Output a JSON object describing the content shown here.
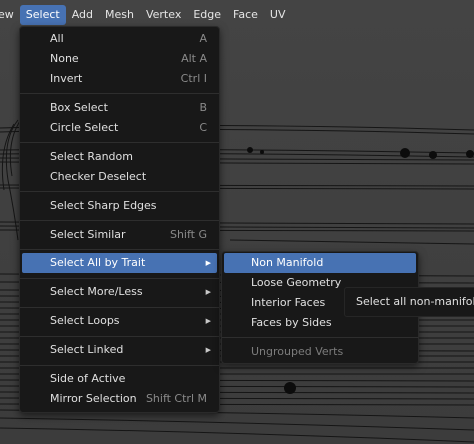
{
  "menubar": {
    "items": [
      {
        "label": "ew",
        "name": "menubar-view"
      },
      {
        "label": "Select",
        "name": "menubar-select"
      },
      {
        "label": "Add",
        "name": "menubar-add"
      },
      {
        "label": "Mesh",
        "name": "menubar-mesh"
      },
      {
        "label": "Vertex",
        "name": "menubar-vertex"
      },
      {
        "label": "Edge",
        "name": "menubar-edge"
      },
      {
        "label": "Face",
        "name": "menubar-face"
      },
      {
        "label": "UV",
        "name": "menubar-uv"
      }
    ],
    "active": "Select"
  },
  "select_menu": {
    "items": [
      {
        "label": "All",
        "shortcut": "A"
      },
      {
        "label": "None",
        "shortcut": "Alt A"
      },
      {
        "label": "Invert",
        "shortcut": "Ctrl I"
      },
      {
        "label": "Box Select",
        "shortcut": "B"
      },
      {
        "label": "Circle Select",
        "shortcut": "C"
      },
      {
        "label": "Select Random",
        "shortcut": ""
      },
      {
        "label": "Checker Deselect",
        "shortcut": ""
      },
      {
        "label": "Select Sharp Edges",
        "shortcut": ""
      },
      {
        "label": "Select Similar",
        "shortcut": "Shift G"
      },
      {
        "label": "Select All by Trait",
        "shortcut": ""
      },
      {
        "label": "Select More/Less",
        "shortcut": ""
      },
      {
        "label": "Select Loops",
        "shortcut": ""
      },
      {
        "label": "Select Linked",
        "shortcut": ""
      },
      {
        "label": "Side of Active",
        "shortcut": ""
      },
      {
        "label": "Mirror Selection",
        "shortcut": "Shift Ctrl M"
      }
    ]
  },
  "trait_submenu": {
    "items": [
      {
        "label": "Non Manifold"
      },
      {
        "label": "Loose Geometry"
      },
      {
        "label": "Interior Faces"
      },
      {
        "label": "Faces by Sides"
      },
      {
        "label": "Ungrouped Verts"
      }
    ]
  },
  "tooltip": {
    "text": "Select all non-manifold vertices or edges"
  },
  "colors": {
    "highlight": "#4772b3",
    "menu_bg": "#181818",
    "viewport_bg": "#3d3d3d"
  }
}
